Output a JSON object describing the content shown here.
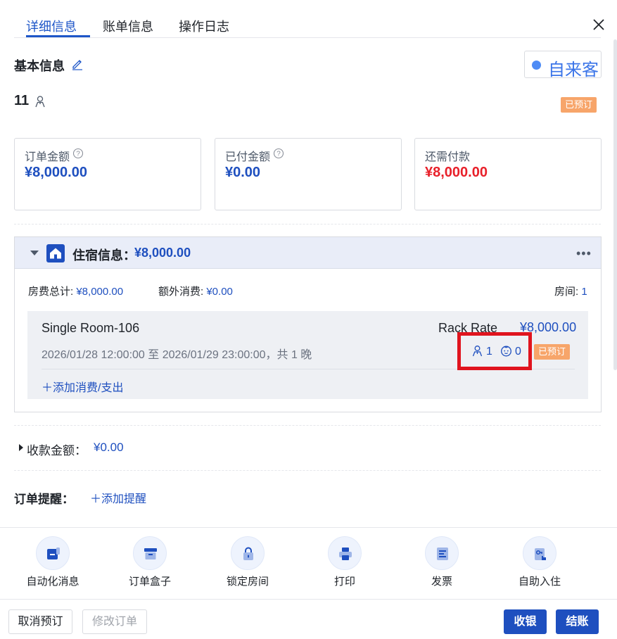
{
  "tabs": [
    {
      "label": "详细信息",
      "active": true
    },
    {
      "label": "账单信息",
      "active": false
    },
    {
      "label": "操作日志",
      "active": false
    }
  ],
  "basic_info": {
    "title": "基本信息",
    "source": "自来客",
    "guest_count": "11",
    "status": "已预订"
  },
  "amounts": [
    {
      "label": "订单金额",
      "value": "¥8,000.00",
      "has_help": true
    },
    {
      "label": "已付金额",
      "value": "¥0.00",
      "has_help": true
    },
    {
      "label": "还需付款",
      "value": "¥8,000.00",
      "has_help": false
    }
  ],
  "accommodation": {
    "title": "住宿信息：",
    "total": "¥8,000.00",
    "room_fee_label": "房费总计: ",
    "room_fee_value": "¥8,000.00",
    "extra_label": "额外消费: ",
    "extra_value": "¥0.00",
    "rooms_label": "房间: ",
    "rooms_value": "1",
    "room": {
      "name": "Single Room-106",
      "rate_name": "Rack Rate",
      "price": "¥8,000.00",
      "dates": "2026/01/28 12:00:00 至 2026/01/29 23:00:00，共 1 晚",
      "adults": "1",
      "children": "0",
      "status": "已预订",
      "add_expense": "添加消费/支出"
    }
  },
  "collection": {
    "label": "收款金额：",
    "value": "¥0.00"
  },
  "reminder": {
    "label": "订单提醒：",
    "add": "添加提醒"
  },
  "actions": [
    {
      "label": "自动化消息",
      "icon": "message-icon"
    },
    {
      "label": "订单盒子",
      "icon": "box-icon"
    },
    {
      "label": "锁定房间",
      "icon": "lock-icon"
    },
    {
      "label": "打印",
      "icon": "printer-icon"
    },
    {
      "label": "发票",
      "icon": "invoice-icon"
    },
    {
      "label": "自助入住",
      "icon": "self-checkin-icon"
    }
  ],
  "footer": {
    "cancel": "取消预订",
    "modify": "修改订单",
    "cashier": "收银",
    "checkout": "结账"
  },
  "colors": {
    "primary": "#1e4fbf",
    "danger": "#e8202a",
    "badge": "#f7a56a",
    "highlight": "#e0141e"
  }
}
